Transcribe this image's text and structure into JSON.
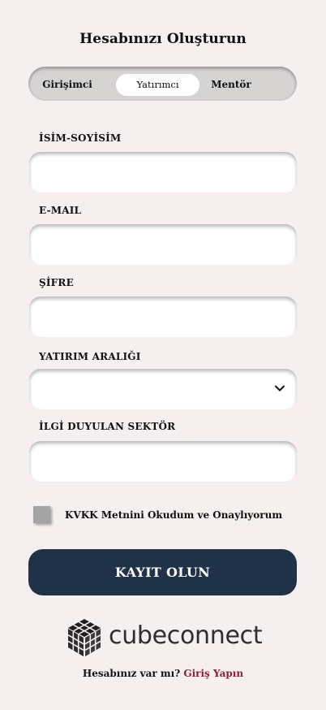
{
  "title": "Hesabınızı Oluşturun",
  "role_tabs": [
    {
      "label": "Girişimci",
      "selected": false
    },
    {
      "label": "Yatırımcı",
      "selected": true
    },
    {
      "label": "Mentör",
      "selected": false
    }
  ],
  "form": {
    "name_label": "İSİM-SOYİSİM",
    "name_value": "",
    "email_label": "E-MAIL",
    "email_value": "",
    "password_label": "ŞİFRE",
    "password_value": "",
    "investment_range_label": "YATIRIM ARALIĞI",
    "investment_range_value": "",
    "sector_label": "İLGİ DUYULAN SEKTÖR",
    "sector_value": "",
    "kvkk_text": "KVKK Metnini Okudum ve Onaylıyorum",
    "kvkk_checked": false,
    "submit_label": "KAYIT OLUN"
  },
  "brand": {
    "name": "cubeconnect",
    "icon": "cube-logo-icon"
  },
  "footer": {
    "question": "Hesabınız var mı?",
    "login_link": "Giriş Yapın"
  },
  "colors": {
    "background": "#f5efef",
    "button": "#203247",
    "link": "#8b1e3f"
  }
}
